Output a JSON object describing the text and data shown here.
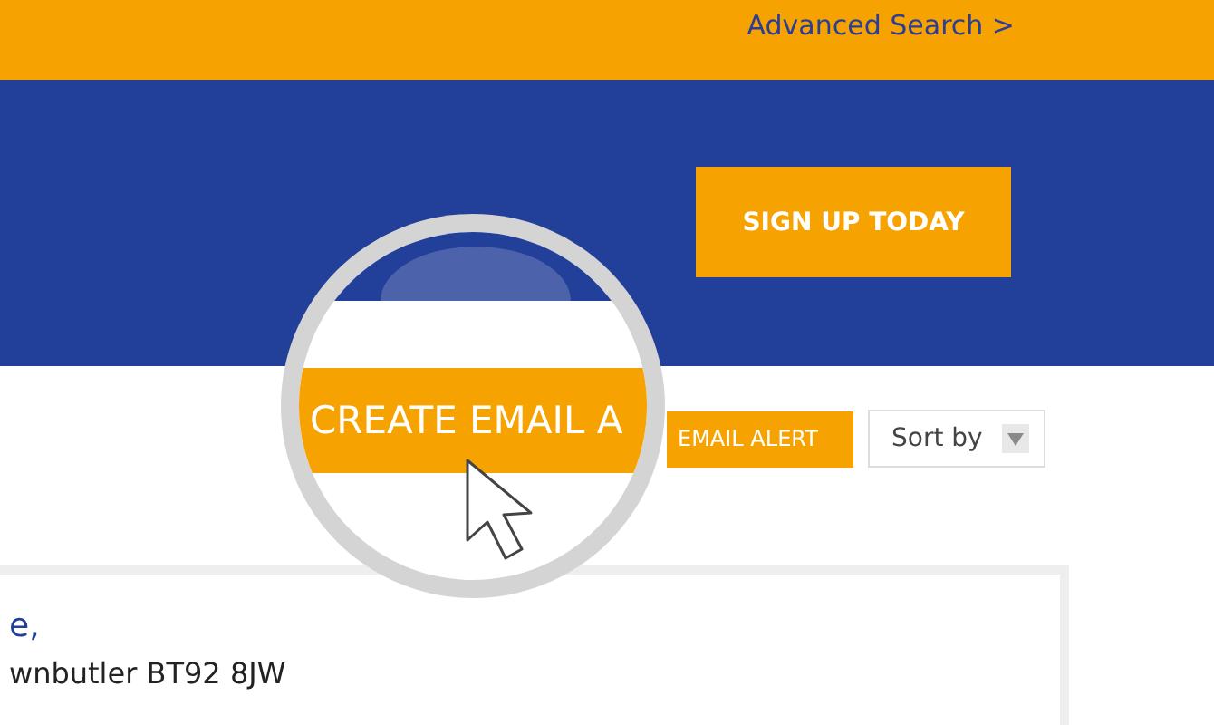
{
  "header": {
    "link": "Advanced Search >"
  },
  "banner": {
    "button": "SIGN UP TODAY"
  },
  "toolbar": {
    "email_alert_button": "EMAIL ALERT",
    "sort": {
      "label": "Sort by"
    }
  },
  "result_card": {
    "title": "e,",
    "address": "wnbutler BT92 8JW"
  },
  "magnifier": {
    "button": "CREATE EMAIL A"
  }
}
